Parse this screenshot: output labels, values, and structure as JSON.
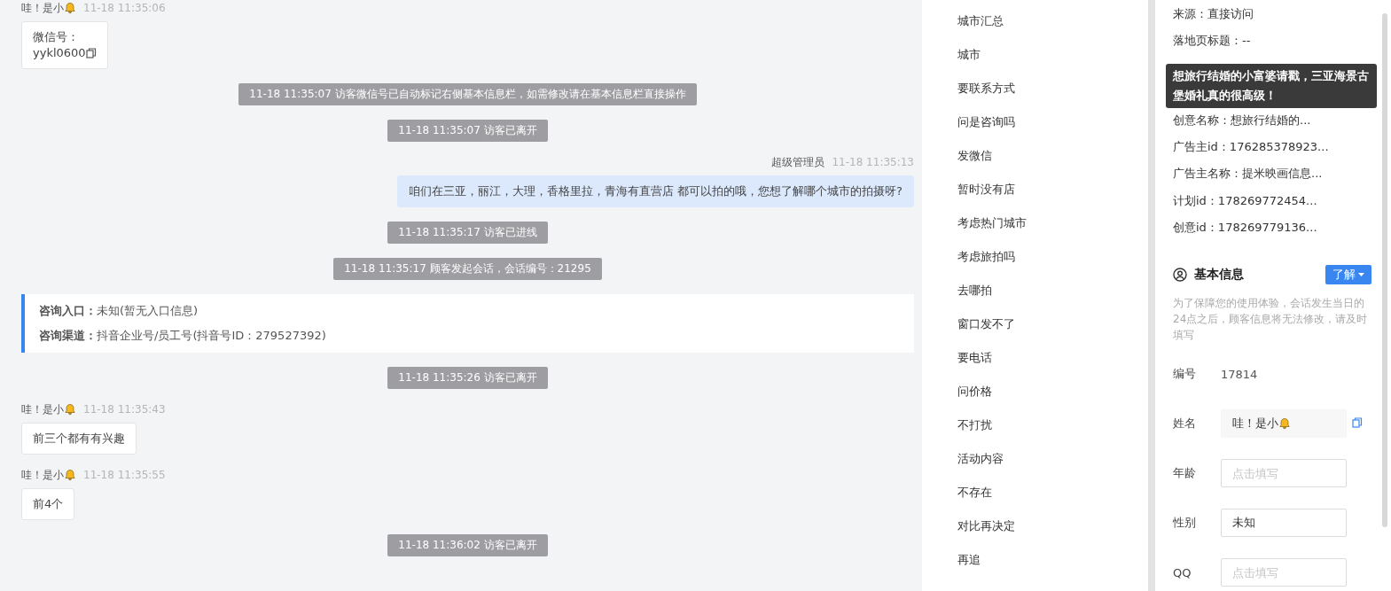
{
  "chat": {
    "messages": [
      {
        "kind": "visitor",
        "name": "哇！是小",
        "time": "11-18 11:35:06",
        "text": "微信号：",
        "wechat": "yykl0600"
      },
      {
        "kind": "system",
        "text": "11-18 11:35:07 访客微信号已自动标记右侧基本信息栏，如需修改请在基本信息栏直接操作"
      },
      {
        "kind": "system",
        "text": "11-18 11:35:07 访客已离开"
      },
      {
        "kind": "agent",
        "name": "超级管理员",
        "time": "11-18 11:35:13",
        "text": "咱们在三亚，丽江，大理，香格里拉，青海有直营店 都可以拍的哦，您想了解哪个城市的拍摄呀?"
      },
      {
        "kind": "system",
        "text": "11-18 11:35:17 访客已进线"
      },
      {
        "kind": "system",
        "text": "11-18 11:35:17 顾客发起会话，会话编号：21295"
      },
      {
        "kind": "entry",
        "rows": [
          {
            "label": "咨询入口：",
            "value": "未知(暂无入口信息)"
          },
          {
            "label": "咨询渠道：",
            "value": "抖音企业号/员工号(抖音号ID：279527392)"
          }
        ]
      },
      {
        "kind": "system",
        "text": "11-18 11:35:26 访客已离开"
      },
      {
        "kind": "visitor",
        "name": "哇！是小",
        "time": "11-18 11:35:43",
        "text": "前三个都有有兴趣"
      },
      {
        "kind": "visitor",
        "name": "哇！是小",
        "time": "11-18 11:35:55",
        "text": "前4个"
      },
      {
        "kind": "system",
        "text": "11-18 11:36:02 访客已离开"
      }
    ]
  },
  "quick_replies": [
    "城市汇总",
    "城市",
    "要联系方式",
    "问是咨询吗",
    "发微信",
    "暂时没有店",
    "考虑热门城市",
    "考虑旅拍吗",
    "去哪拍",
    "窗口发不了",
    "要电话",
    "问价格",
    "不打扰",
    "活动内容",
    "不存在",
    "对比再决定",
    "再追"
  ],
  "source_info": {
    "lines_before": [
      "来源：直接访问",
      "落地页标题：--"
    ],
    "tooltip": "想旅行结婚的小富婆请戳，三亚海景古堡婚礼真的很高级！",
    "lines_after": [
      "创意名称：想旅行结婚的...",
      "广告主id：176285378923...",
      "广告主名称：提米映画信息...",
      "计划id：178269772454...",
      "创意id：178269779136..."
    ]
  },
  "basic_info": {
    "title": "基本信息",
    "button": "了解",
    "note": "为了保障您的使用体验，会话发生当日的24点之后，顾客信息将无法修改，请及时填写",
    "fields": [
      {
        "kind": "text",
        "label": "编号",
        "value": "17814"
      },
      {
        "kind": "name",
        "label": "姓名",
        "value": "哇！是小"
      },
      {
        "kind": "input",
        "label": "年龄",
        "placeholder": "点击填写"
      },
      {
        "kind": "select",
        "label": "性别",
        "value": "未知"
      },
      {
        "kind": "input",
        "label": "QQ",
        "placeholder": "点击填写"
      }
    ]
  }
}
